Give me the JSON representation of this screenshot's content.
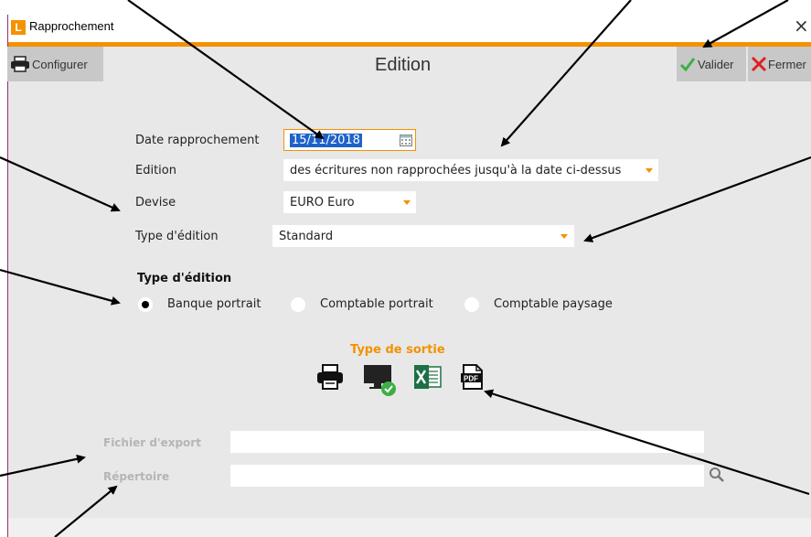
{
  "window": {
    "title": "Rapprochement",
    "logo_letter": "L",
    "close_glyph": "×"
  },
  "toolbar": {
    "configure_label": "Configurer",
    "validate_label": "Valider",
    "close_label": "Fermer",
    "heading": "Edition"
  },
  "form": {
    "date_label": "Date rapprochement",
    "date_value": "15/11/2018",
    "edition_label": "Edition",
    "edition_value": "des écritures non rapprochées jusqu'à la date ci-dessus",
    "devise_label": "Devise",
    "devise_value": "EURO Euro",
    "type_edition_label": "Type d'édition",
    "type_edition_value": "Standard"
  },
  "type_edition_group": {
    "title": "Type d'édition",
    "options": [
      "Banque portrait",
      "Comptable portrait",
      "Comptable paysage"
    ],
    "selected": "Banque portrait"
  },
  "output": {
    "title": "Type de sortie",
    "icons": [
      "printer-icon",
      "screen-icon",
      "excel-icon",
      "pdf-icon"
    ],
    "pdf_text": "PDF"
  },
  "export": {
    "file_label": "Fichier d'export",
    "file_value": "",
    "dir_label": "Répertoire",
    "dir_value": ""
  },
  "colors": {
    "accent": "#f39200",
    "panel": "#e8e8e8",
    "toolbar_button": "#c8c8c8",
    "valid_green": "#3cb043",
    "close_red": "#e02020"
  }
}
